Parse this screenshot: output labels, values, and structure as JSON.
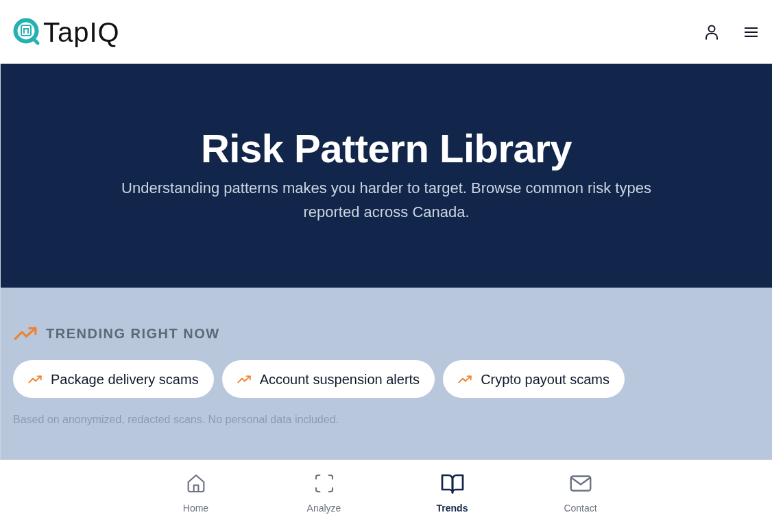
{
  "header": {
    "logo_text": "TapIQ"
  },
  "hero": {
    "title": "Risk Pattern Library",
    "subtitle": "Understanding patterns makes you harder to target. Browse common risk types reported across Canada."
  },
  "trending": {
    "heading": "TRENDING RIGHT NOW",
    "pills": [
      "Package delivery scams",
      "Account suspension alerts",
      "Crypto payout scams"
    ],
    "note": "Based on anonymized, redacted scans. No personal data included."
  },
  "bottom_nav": [
    {
      "label": "Home",
      "selected": false
    },
    {
      "label": "Analyze",
      "selected": false
    },
    {
      "label": "Trends",
      "selected": true
    },
    {
      "label": "Contact",
      "selected": false
    }
  ]
}
